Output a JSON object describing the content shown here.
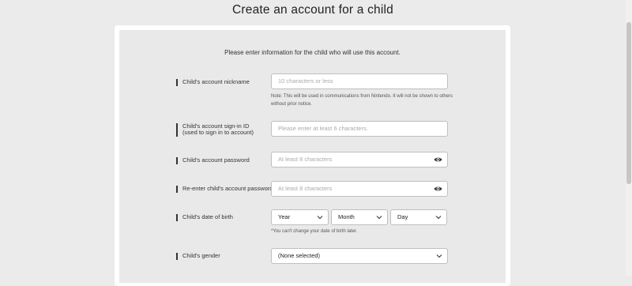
{
  "page": {
    "title": "Create an account for a child"
  },
  "form": {
    "intro": "Please enter information for the child who will use this account.",
    "nickname": {
      "label": "Child's account nickname",
      "placeholder": "10 characters or less",
      "note": "Note: This will be used in communications from Nintendo. It will not be shown to others without prior notice."
    },
    "signin": {
      "label_line1": "Child's account sign-in ID",
      "label_line2": "(used to sign in to account)",
      "placeholder": "Please enter at least 6 characters."
    },
    "password": {
      "label": "Child's account password",
      "placeholder": "At least 8 characters"
    },
    "password_confirm": {
      "label": "Re-enter child's account password",
      "placeholder": "At least 8 characters"
    },
    "birth": {
      "label": "Child's date of birth",
      "year": "Year",
      "month": "Month",
      "day": "Day",
      "note": "*You can't change your date of birth later."
    },
    "gender": {
      "label": "Child's gender",
      "value": "(None selected)"
    }
  }
}
